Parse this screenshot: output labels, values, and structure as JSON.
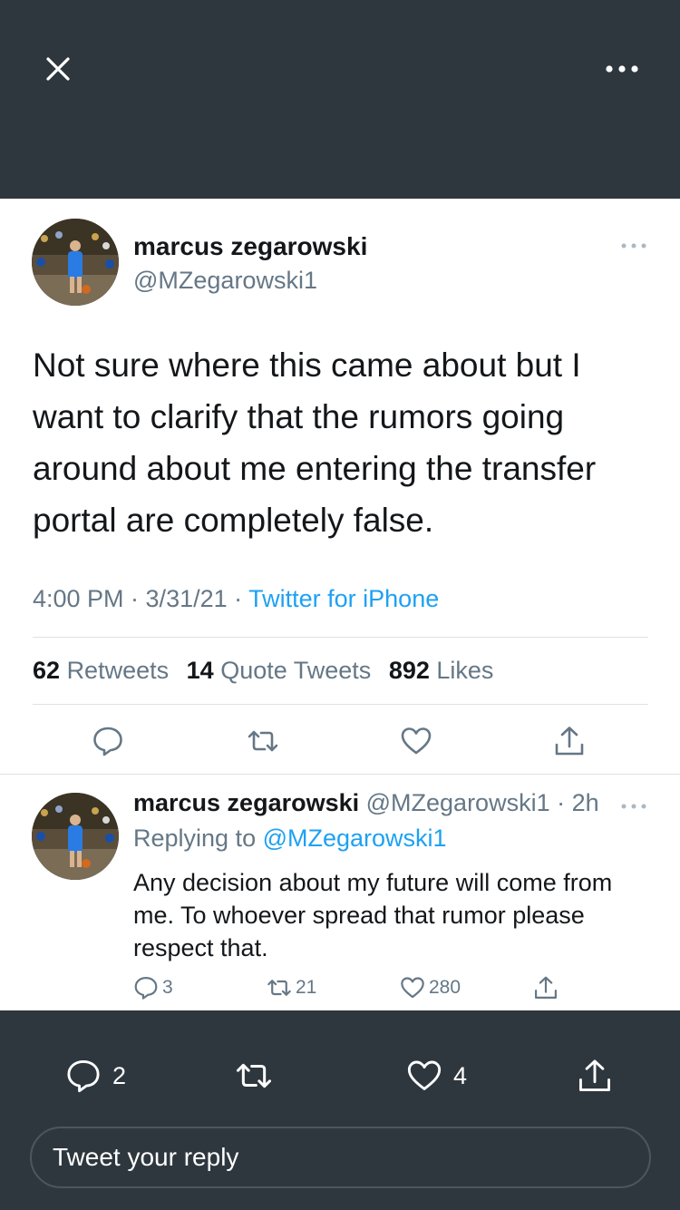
{
  "main_tweet": {
    "author_name": "marcus zegarowski",
    "author_handle": "@MZegarowski1",
    "text": "Not sure where this came about but I want to clarify that the rumors going around about me entering the transfer portal are completely false.",
    "time": "4:00 PM · 3/31/21 · ",
    "source": "Twitter for iPhone",
    "stats": {
      "retweets_count": "62",
      "retweets_label": "Retweets",
      "quotes_count": "14",
      "quotes_label": "Quote Tweets",
      "likes_count": "892",
      "likes_label": "Likes"
    }
  },
  "reply_tweet": {
    "author_name": "marcus zegarowski",
    "handle_time": " @MZegarowski1 · 2h",
    "replying_prefix": "Replying to ",
    "replying_to": "@MZegarowski1",
    "text": "Any decision about my future will come from me. To whoever spread that rumor please respect that.",
    "reply_count": "3",
    "retweet_count": "21",
    "like_count": "280"
  },
  "bottom_bar": {
    "reply_count": "2",
    "like_count": "4",
    "reply_placeholder": "Tweet your reply"
  },
  "colors": {
    "dark_bg": "#2f373e",
    "accent": "#1da1f2",
    "muted": "#657786",
    "text": "#14171a"
  }
}
